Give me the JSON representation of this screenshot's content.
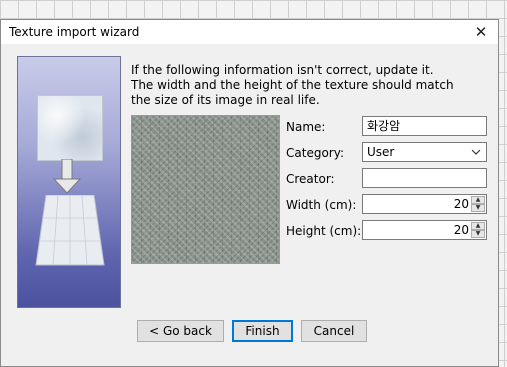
{
  "dialog": {
    "title": "Texture import wizard",
    "close_symbol": "✕"
  },
  "intro": {
    "line1": "If the following information isn't correct, update it.",
    "line2": "The width and the height of the texture should match",
    "line3": "the size of its image in real life."
  },
  "form": {
    "name_label": "Name:",
    "name_value": "화강암",
    "category_label": "Category:",
    "category_value": "User",
    "creator_label": "Creator:",
    "creator_value": "",
    "width_label": "Width (cm):",
    "width_value": "20",
    "height_label": "Height (cm):",
    "height_value": "20"
  },
  "buttons": {
    "back": "< Go back",
    "finish": "Finish",
    "cancel": "Cancel"
  },
  "icons": {
    "close": "close-icon",
    "dropdown": "chevron-down-icon",
    "spin_up": "spin-up-icon",
    "spin_down": "spin-down-icon"
  }
}
